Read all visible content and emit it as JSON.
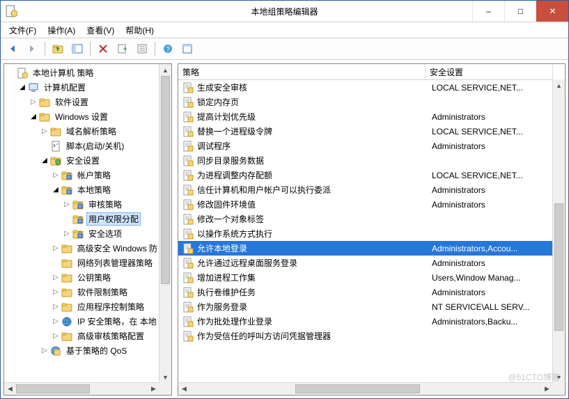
{
  "title": "本地组策略编辑器",
  "window_controls": {
    "min": "–",
    "max": "□",
    "close": "✕"
  },
  "menu": {
    "file": "文件(F)",
    "action": "操作(A)",
    "view": "查看(V)",
    "help": "帮助(H)"
  },
  "toolbar_icons": {
    "back": "back-icon",
    "forward": "forward-icon",
    "up": "up-icon",
    "show_hide": "show-hide-tree-icon",
    "delete": "delete-icon",
    "export": "export-list-icon",
    "properties": "properties-icon",
    "help": "help-icon",
    "refresh": "refresh-icon"
  },
  "tree": {
    "root": {
      "label": "本地计算机 策略",
      "icon": "policy-root"
    },
    "computer_cfg": {
      "label": "计算机配置",
      "icon": "computer"
    },
    "software": {
      "label": "软件设置",
      "icon": "folder"
    },
    "windows": {
      "label": "Windows 设置",
      "icon": "folder"
    },
    "dns_policy": {
      "label": "域名解析策略",
      "icon": "folder"
    },
    "scripts": {
      "label": "脚本(启动/关机)",
      "icon": "script"
    },
    "security": {
      "label": "安全设置",
      "icon": "security"
    },
    "account_policy": {
      "label": "帐户策略",
      "icon": "folder-lock"
    },
    "local_policy": {
      "label": "本地策略",
      "icon": "folder-lock"
    },
    "audit_policy": {
      "label": "审核策略",
      "icon": "folder-lock"
    },
    "user_rights": {
      "label": "用户权限分配",
      "icon": "folder-lock"
    },
    "security_options": {
      "label": "安全选项",
      "icon": "folder-lock"
    },
    "adv_windows": {
      "label": "高级安全 Windows 防",
      "icon": "folder"
    },
    "nlm": {
      "label": "网络列表管理器策略",
      "icon": "folder"
    },
    "pubkey": {
      "label": "公钥策略",
      "icon": "folder"
    },
    "srp": {
      "label": "软件限制策略",
      "icon": "folder"
    },
    "appctrl": {
      "label": "应用程序控制策略",
      "icon": "folder"
    },
    "ipsec": {
      "label": "IP 安全策略，在 本地",
      "icon": "ipsec"
    },
    "adv_audit": {
      "label": "高级审核策略配置",
      "icon": "folder"
    },
    "qos": {
      "label": "基于策略的 QoS",
      "icon": "qos"
    }
  },
  "columns": {
    "policy": "策略",
    "setting": "安全设置"
  },
  "policies": [
    {
      "name": "生成安全审核",
      "setting": "LOCAL SERVICE,NET..."
    },
    {
      "name": "锁定内存页",
      "setting": ""
    },
    {
      "name": "提高计划优先级",
      "setting": "Administrators"
    },
    {
      "name": "替换一个进程级令牌",
      "setting": "LOCAL SERVICE,NET..."
    },
    {
      "name": "调试程序",
      "setting": "Administrators"
    },
    {
      "name": "同步目录服务数据",
      "setting": ""
    },
    {
      "name": "为进程调整内存配额",
      "setting": "LOCAL SERVICE,NET..."
    },
    {
      "name": "信任计算机和用户帐户可以执行委派",
      "setting": "Administrators"
    },
    {
      "name": "修改固件环境值",
      "setting": "Administrators"
    },
    {
      "name": "修改一个对象标签",
      "setting": ""
    },
    {
      "name": "以操作系统方式执行",
      "setting": ""
    },
    {
      "name": "允许本地登录",
      "setting": "Administrators,Accou...",
      "selected": true
    },
    {
      "name": "允许通过远程桌面服务登录",
      "setting": "Administrators"
    },
    {
      "name": "增加进程工作集",
      "setting": "Users,Window Manag..."
    },
    {
      "name": "执行卷维护任务",
      "setting": "Administrators"
    },
    {
      "name": "作为服务登录",
      "setting": "NT SERVICE\\ALL SERV..."
    },
    {
      "name": "作为批处理作业登录",
      "setting": "Administrators,Backu..."
    },
    {
      "name": "作为受信任的呼叫方访问凭据管理器",
      "setting": ""
    }
  ],
  "watermark": "@51CTO博客"
}
